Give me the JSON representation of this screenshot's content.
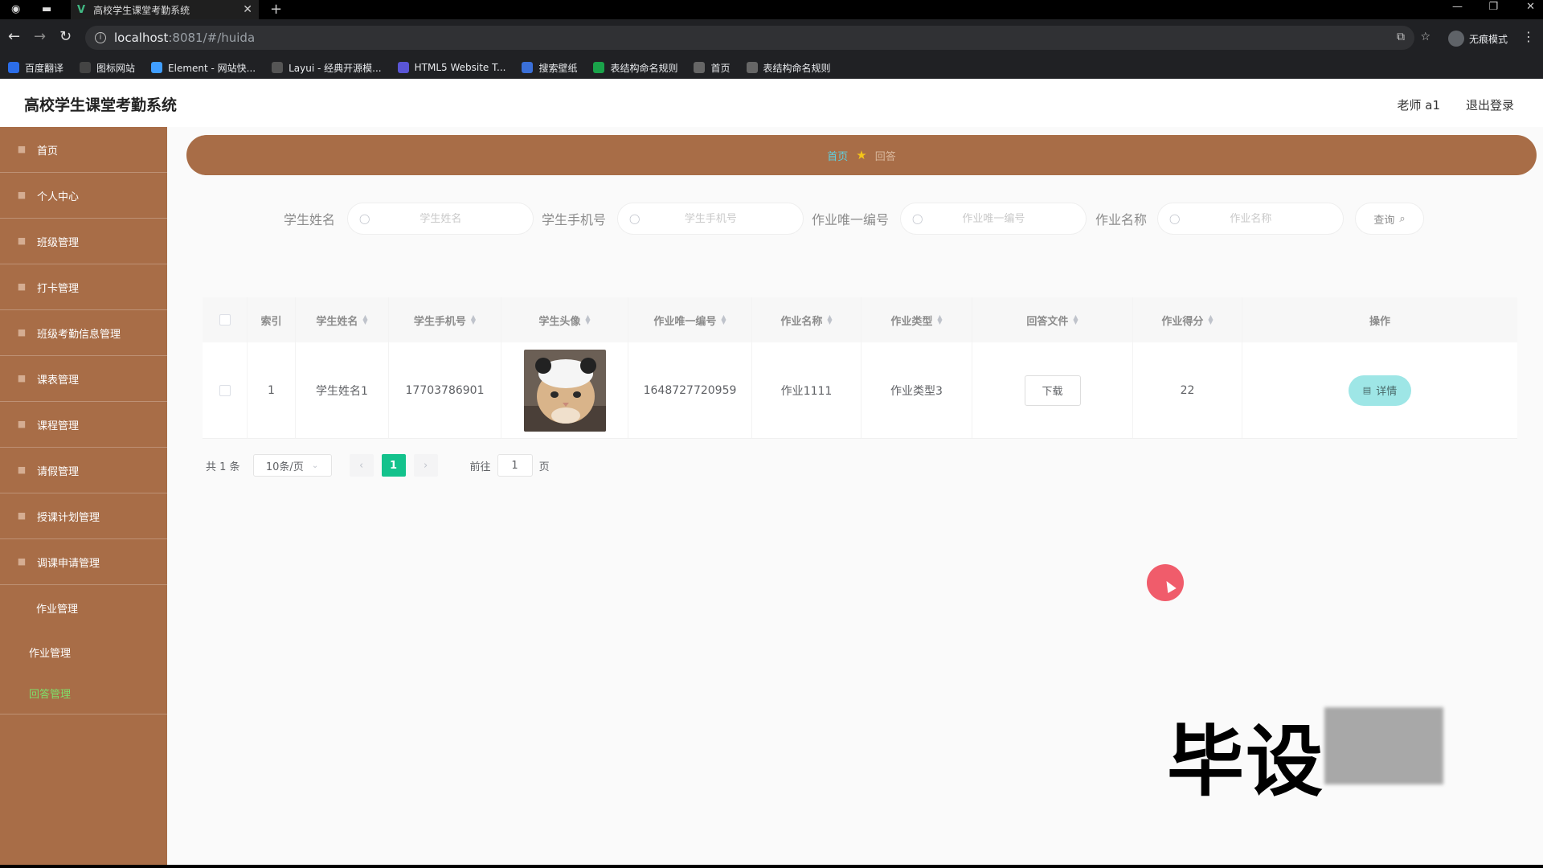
{
  "browser": {
    "tab_title": "高校学生课堂考勤系统",
    "address_host": "localhost",
    "address_path": ":8081/#/huida",
    "incognito_label": "无痕模式",
    "bookmarks": [
      {
        "label": "百度翻译",
        "icon": "baidu-translate-icon",
        "color": "#2b6de8"
      },
      {
        "label": "图标网站",
        "icon": "flag-icon",
        "color": "#444444"
      },
      {
        "label": "Element - 网站快...",
        "icon": "element-icon",
        "color": "#409eff"
      },
      {
        "label": "Layui - 经典开源模...",
        "icon": "layui-icon",
        "color": "#555555"
      },
      {
        "label": "HTML5 Website T...",
        "icon": "html5-icon",
        "color": "#5a55d6"
      },
      {
        "label": "搜索壁纸",
        "icon": "wallpaper-icon",
        "color": "#3a6fd8"
      },
      {
        "label": "表结构命名规则",
        "icon": "table-icon",
        "color": "#1aa34a"
      },
      {
        "label": "首页",
        "icon": "globe-icon",
        "color": "#666666"
      },
      {
        "label": "表结构命名规则",
        "icon": "globe-icon",
        "color": "#666666"
      }
    ]
  },
  "header": {
    "title": "高校学生课堂考勤系统",
    "user": "老师 a1",
    "logout": "退出登录"
  },
  "sidebar": {
    "items": [
      {
        "label": "首页",
        "icon": "home-icon"
      },
      {
        "label": "个人中心",
        "icon": "user-icon"
      },
      {
        "label": "班级管理",
        "icon": "class-icon"
      },
      {
        "label": "打卡管理",
        "icon": "checkin-icon"
      },
      {
        "label": "班级考勤信息管理",
        "icon": "attendance-icon"
      },
      {
        "label": "课表管理",
        "icon": "schedule-icon"
      },
      {
        "label": "课程管理",
        "icon": "course-icon"
      },
      {
        "label": "请假管理",
        "icon": "leave-icon"
      },
      {
        "label": "授课计划管理",
        "icon": "chart-icon"
      },
      {
        "label": "调课申请管理",
        "icon": "swap-icon"
      }
    ],
    "group": {
      "label": "作业管理",
      "children": [
        "作业管理",
        "回答管理"
      ]
    }
  },
  "breadcrumb": {
    "home": "首页",
    "current": "回答"
  },
  "search": {
    "fields": [
      {
        "label": "学生姓名",
        "placeholder": "学生姓名"
      },
      {
        "label": "学生手机号",
        "placeholder": "学生手机号"
      },
      {
        "label": "作业唯一编号",
        "placeholder": "作业唯一编号"
      },
      {
        "label": "作业名称",
        "placeholder": "作业名称"
      }
    ],
    "query_label": "查询"
  },
  "table": {
    "columns": [
      "索引",
      "学生姓名",
      "学生手机号",
      "学生头像",
      "作业唯一编号",
      "作业名称",
      "作业类型",
      "回答文件",
      "作业得分",
      "操作"
    ],
    "rows": [
      {
        "index": "1",
        "name": "学生姓名1",
        "phone": "17703786901",
        "avatar": "cat-avatar-image",
        "hw_id": "1648727720959",
        "hw_name": "作业1111",
        "hw_type": "作业类型3",
        "file_btn": "下载",
        "score": "22",
        "action": "详情"
      }
    ]
  },
  "pagination": {
    "total": "共 1 条",
    "page_size": "10条/页",
    "current_page": "1",
    "goto_label": "前往",
    "goto_value": "1",
    "page_unit": "页"
  },
  "watermark": {
    "text": "毕设"
  },
  "colors": {
    "sidebar": "#a86d47",
    "accent_green": "#13c28c",
    "detail_btn": "#9ee6e6",
    "active_menu": "#7ee06a"
  }
}
